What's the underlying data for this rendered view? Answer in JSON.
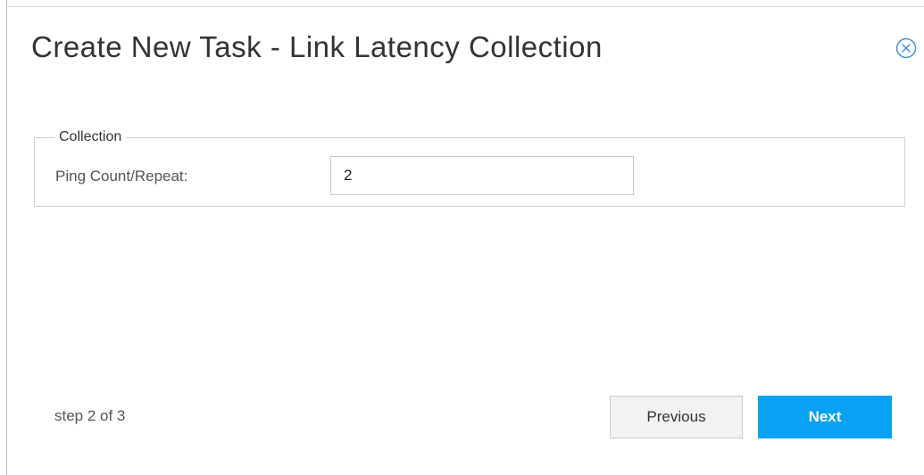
{
  "dialog": {
    "title": "Create New Task - Link Latency Collection",
    "close_icon": "close-circle-icon"
  },
  "collection": {
    "legend": "Collection",
    "ping_label": "Ping Count/Repeat:",
    "ping_value": "2"
  },
  "footer": {
    "step_text": "step 2 of 3",
    "previous_label": "Previous",
    "next_label": "Next"
  },
  "colors": {
    "accent": "#0aa1f2",
    "close_icon": "#3b8fd4"
  }
}
